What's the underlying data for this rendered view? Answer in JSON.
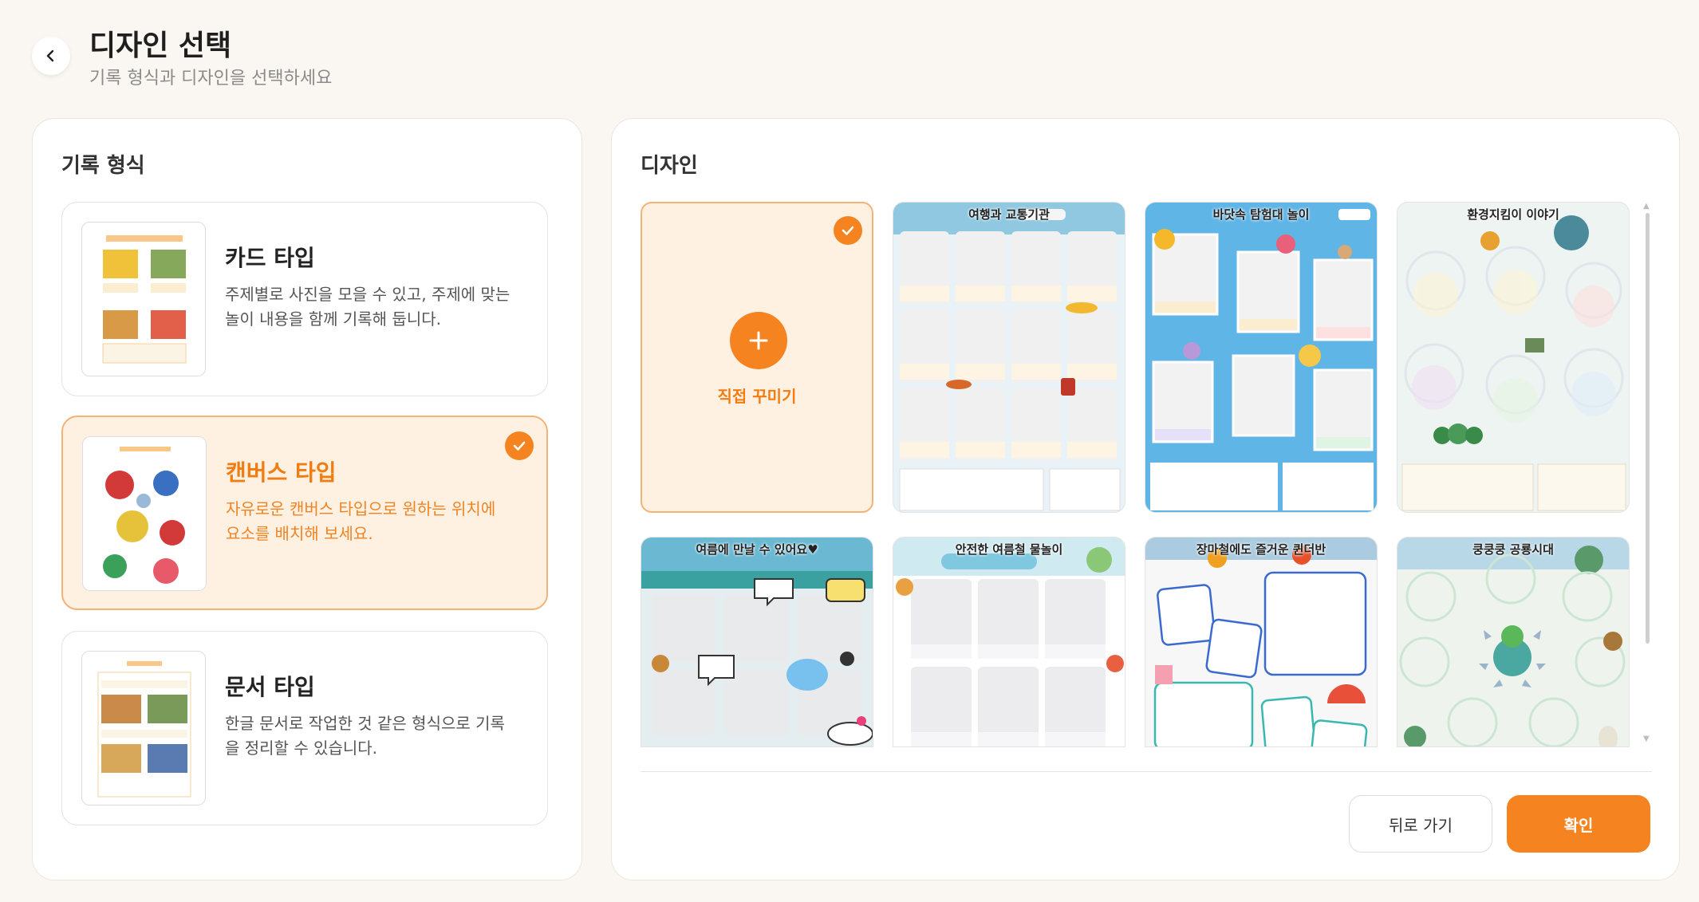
{
  "header": {
    "title": "디자인 선택",
    "subtitle": "기록 형식과 디자인을 선택하세요"
  },
  "record_format": {
    "title": "기록 형식",
    "types": [
      {
        "title": "카드 타입",
        "desc": "주제별로 사진을 모을 수 있고, 주제에 맞는 놀이 내용을 함께 기록해 둡니다.",
        "selected": false
      },
      {
        "title": "캔버스 타입",
        "desc": "자유로운 캔버스 타입으로 원하는 위치에 요소를 배치해 보세요.",
        "selected": true
      },
      {
        "title": "문서 타입",
        "desc": "한글 문서로 작업한 것 같은 형식으로 기록을 정리할 수 있습니다.",
        "selected": false
      }
    ]
  },
  "design": {
    "title": "디자인",
    "custom_label": "직접 꾸미기",
    "templates": [
      {
        "label": "여행과 교통기관",
        "bg": "#e9f3f7"
      },
      {
        "label": "바닷속 탐험대 놀이",
        "bg": "#5fb5e6"
      },
      {
        "label": "환경지킴이 이야기",
        "bg": "#eef4f1"
      },
      {
        "label": "여름에 만날 수 있어요♥",
        "bg": "#e4eef0"
      },
      {
        "label": "안전한 여름철 물놀이",
        "bg": "#ffffff"
      },
      {
        "label": "장마철에도 즐거운 퀸더반",
        "bg": "#f7f7f7"
      },
      {
        "label": "쿵쿵쿵 공룡시대",
        "bg": "#eef3ee"
      }
    ]
  },
  "actions": {
    "back_label": "뒤로 가기",
    "confirm_label": "확인"
  },
  "colors": {
    "accent": "#f5831f",
    "selected_bg": "#fff1e2",
    "selected_border": "#f5b277"
  }
}
